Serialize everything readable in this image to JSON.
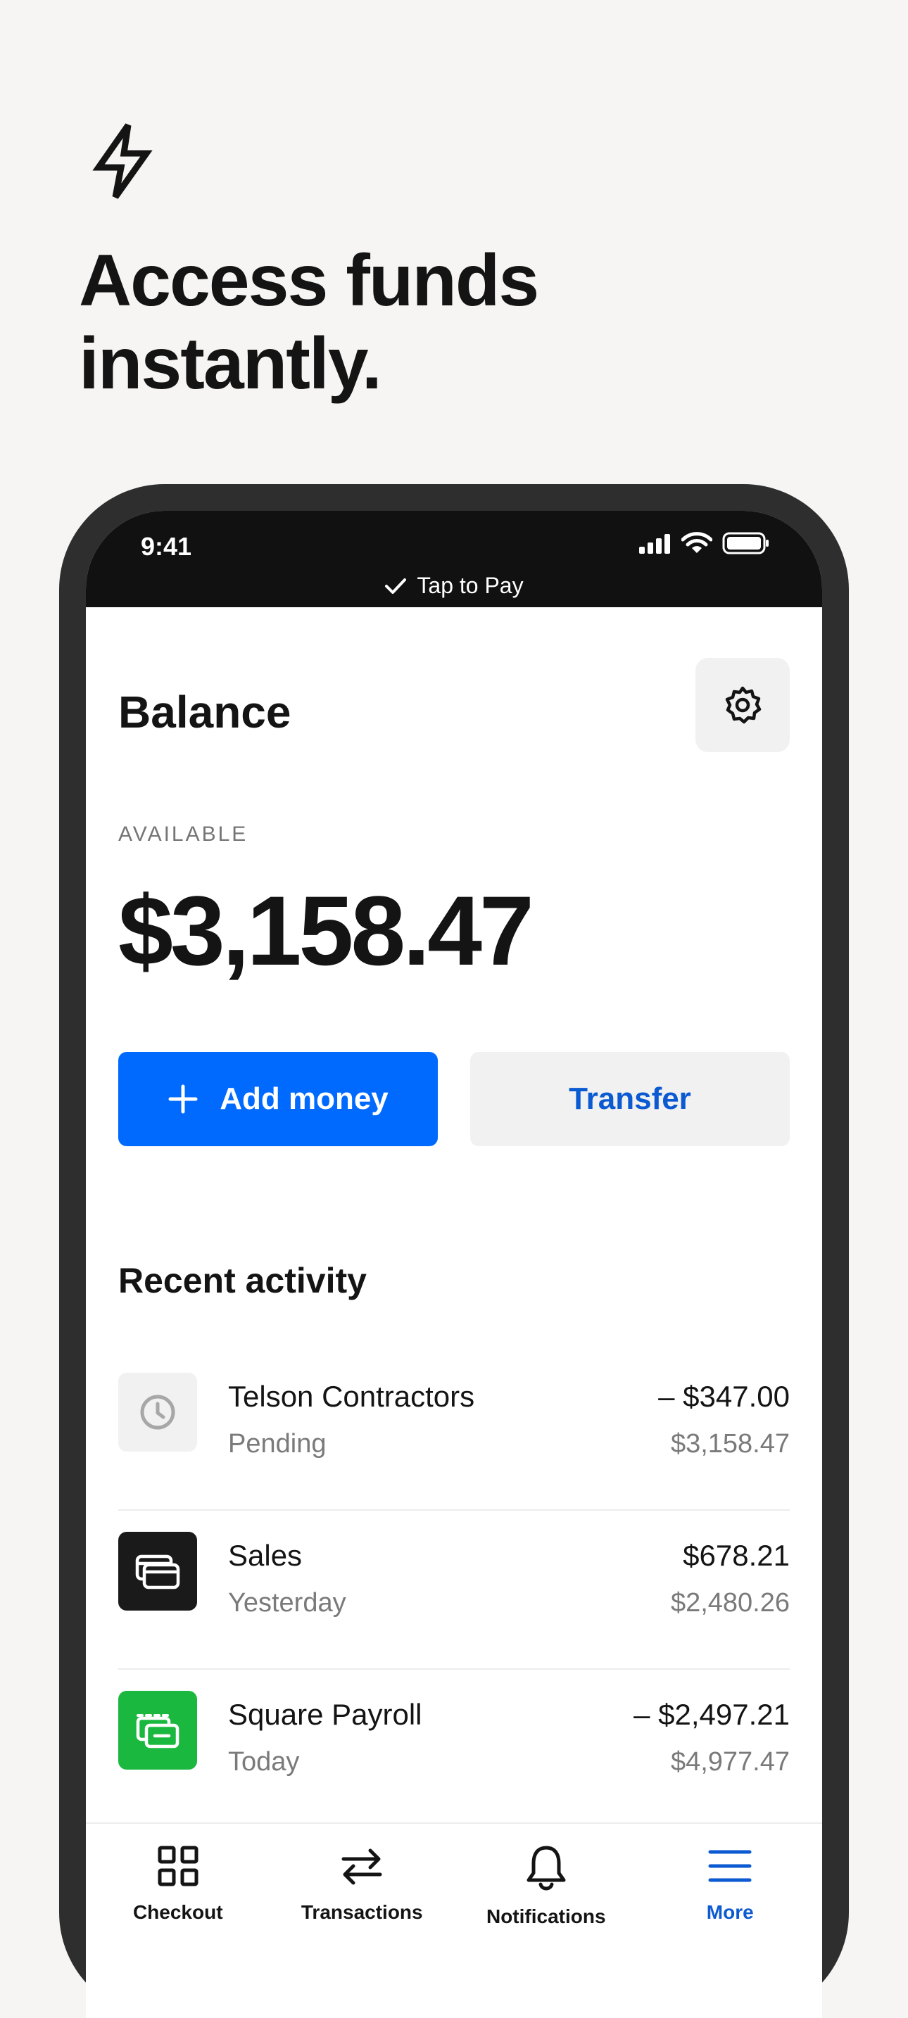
{
  "headline": {
    "line1": "Access funds",
    "line2": "instantly."
  },
  "status_bar": {
    "time": "9:41",
    "tap_to_pay": "Tap to Pay"
  },
  "balance": {
    "title": "Balance",
    "available_label": "AVAILABLE",
    "amount": "$3,158.47"
  },
  "actions": {
    "add_money": "Add money",
    "transfer": "Transfer"
  },
  "recent_activity": {
    "title": "Recent activity",
    "items": [
      {
        "name": "Telson Contractors",
        "status": "Pending",
        "amount": "– $347.00",
        "balance": "$3,158.47",
        "icon": "clock-icon"
      },
      {
        "name": "Sales",
        "status": "Yesterday",
        "amount": "$678.21",
        "balance": "$2,480.26",
        "icon": "cards-icon"
      },
      {
        "name": "Square Payroll",
        "status": "Today",
        "amount": "– $2,497.21",
        "balance": "$4,977.47",
        "icon": "payroll-icon"
      }
    ]
  },
  "tabs": [
    {
      "label": "Checkout",
      "icon": "grid-icon"
    },
    {
      "label": "Transactions",
      "icon": "arrows-icon"
    },
    {
      "label": "Notifications",
      "icon": "bell-icon"
    },
    {
      "label": "More",
      "icon": "menu-icon",
      "active": true
    }
  ],
  "colors": {
    "accent": "#006aff",
    "link": "#0c5ad1",
    "payroll_green": "#1bb83f"
  }
}
